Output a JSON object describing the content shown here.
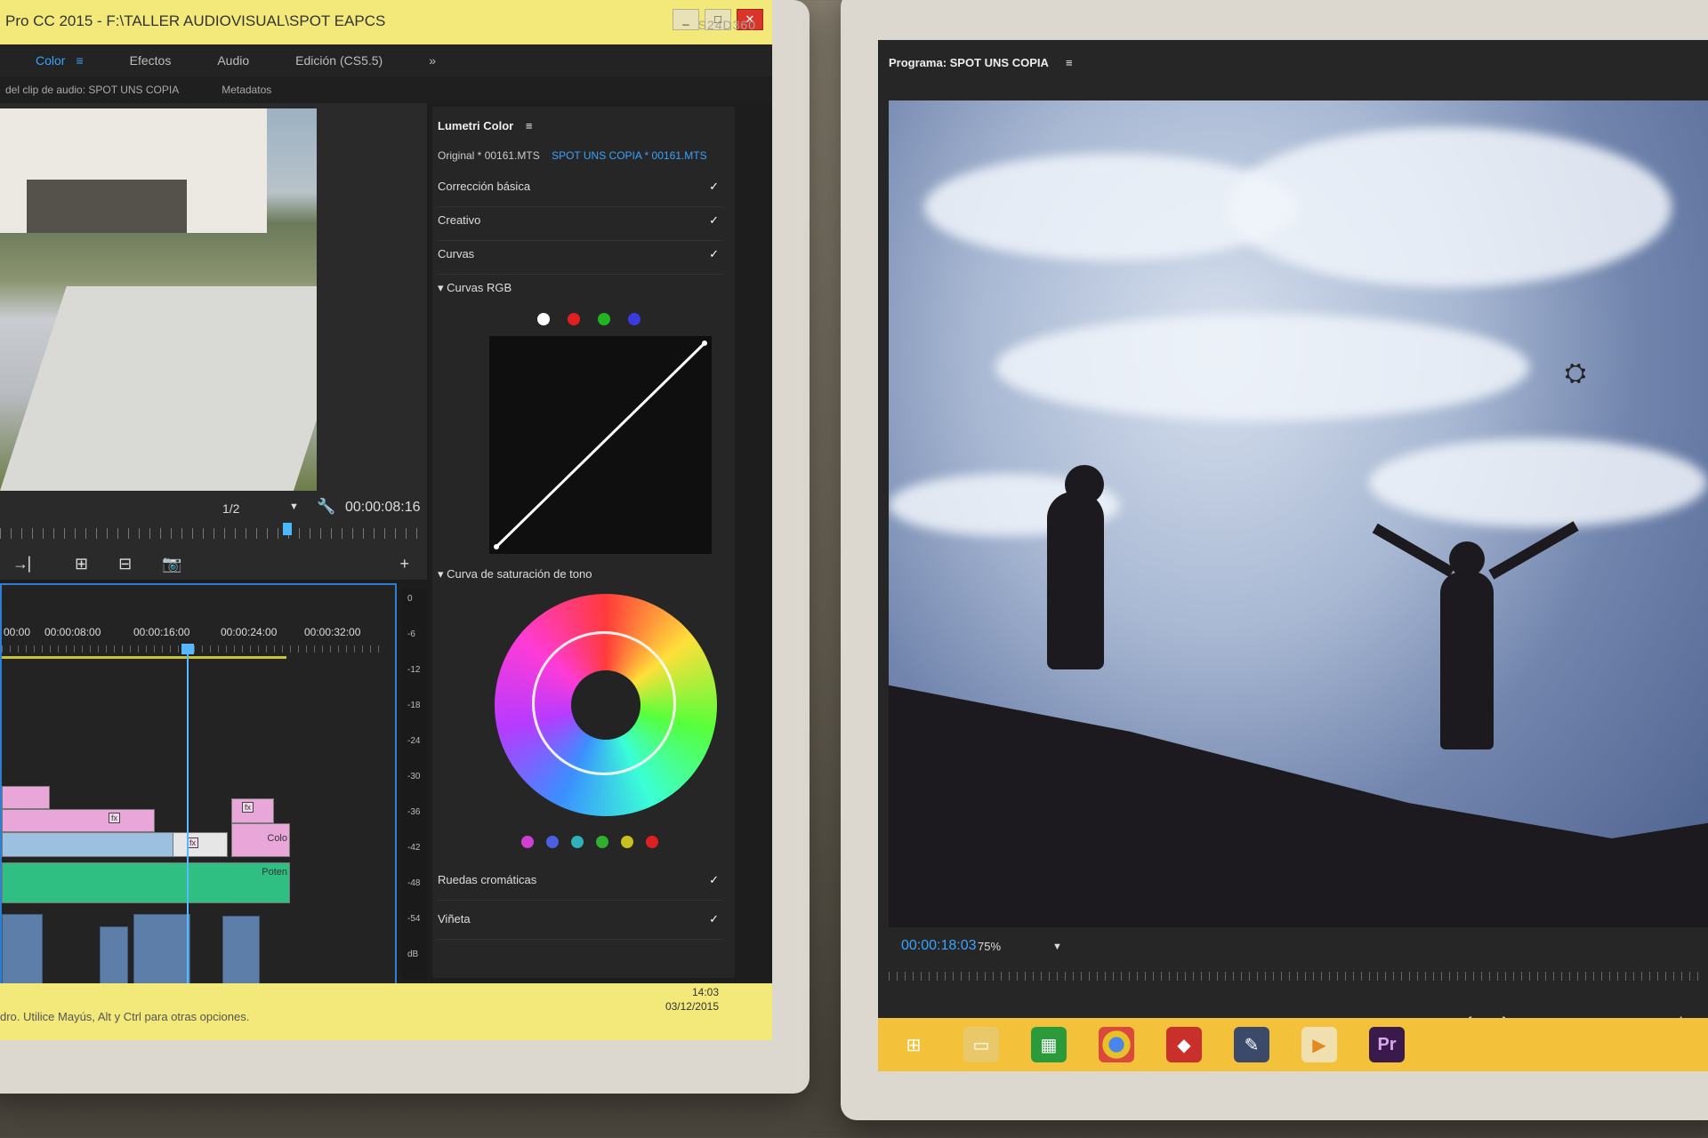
{
  "left_window": {
    "title": "Pro CC 2015 - F:\\TALLER AUDIOVISUAL\\SPOT EAPCS",
    "window_controls": {
      "minimize": "_",
      "maximize": "□",
      "close": "✕"
    },
    "workspaces": [
      "Color",
      "Efectos",
      "Audio",
      "Edición (CS5.5)"
    ],
    "active_workspace": "Color",
    "more_icon": "»",
    "source_panel": {
      "tab_label": "del clip de audio: SPOT UNS COPIA",
      "metadata_tab": "Metadatos",
      "resolution": "1/2",
      "timecode": "00:00:08:16"
    },
    "timeline": {
      "times": [
        "00:00",
        "00:00:08:00",
        "00:00:16:00",
        "00:00:24:00",
        "00:00:32:00"
      ],
      "clip_labels": [
        "Colo",
        "Poten"
      ]
    },
    "vu_scale": [
      "0",
      "-6",
      "-12",
      "-18",
      "-24",
      "-30",
      "-36",
      "-42",
      "-48",
      "-54",
      "dB"
    ],
    "lumetri": {
      "title": "Lumetri Color",
      "source": "Original * 00161.MTS",
      "sequence": "SPOT UNS COPIA * 00161.MTS",
      "sections": [
        {
          "label": "Corrección básica",
          "checked": true
        },
        {
          "label": "Creativo",
          "checked": true
        },
        {
          "label": "Curvas",
          "checked": true
        }
      ],
      "rgb_curves_label": "Curvas RGB",
      "curve_channel_colors": [
        "#ffffff",
        "#e02020",
        "#22b422",
        "#3a3ae0"
      ],
      "hue_sat_label": "Curva de saturación de tono",
      "hue_swatch_colors": [
        "#d040d0",
        "#4a60e0",
        "#30b0b8",
        "#30b030",
        "#c8c020",
        "#e02020"
      ],
      "color_wheels_label": "Ruedas cromáticas",
      "vignette_label": "Viñeta"
    },
    "taskbar": {
      "status": "dro. Utilice Mayús, Alt y Ctrl para otras opciones.",
      "time": "14:03",
      "date": "03/12/2015"
    },
    "bezel_brand": "S24D360"
  },
  "right_window": {
    "program_title": "Programa: SPOT UNS COPIA",
    "timecode": "00:00:18:03",
    "zoom": "75%",
    "transport_icons": [
      "marker-icon",
      "in-point-icon",
      "out-point-icon",
      "go-to-in-icon",
      "step-back-icon",
      "play-icon",
      "step-forward-icon"
    ],
    "taskbar_apps": [
      "windows-start-icon",
      "file-explorer-icon",
      "store-icon",
      "chrome-icon",
      "3d-app-icon",
      "tool-app-icon",
      "media-player-icon",
      "premiere-icon"
    ],
    "premiere_label": "Pr"
  }
}
